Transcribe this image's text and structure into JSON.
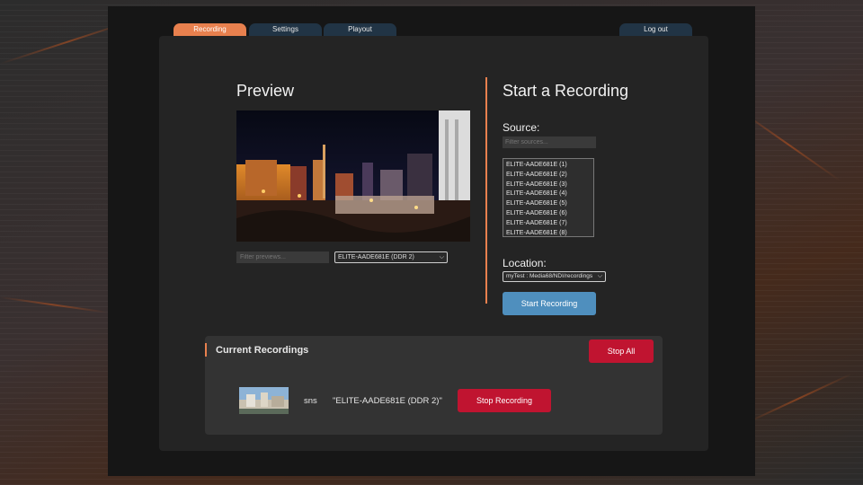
{
  "nav": {
    "tabs": [
      {
        "label": "Recording",
        "active": true
      },
      {
        "label": "Settings",
        "active": false
      },
      {
        "label": "Playout",
        "active": false
      }
    ],
    "logout_label": "Log out"
  },
  "preview": {
    "title": "Preview",
    "filter_placeholder": "Filter previews...",
    "selected_source": "ELITE-AADE681E (DDR 2)"
  },
  "start": {
    "title": "Start a Recording",
    "source_label": "Source:",
    "filter_placeholder": "Filter sources...",
    "sources": [
      "ELITE-AADE681E (1)",
      "ELITE-AADE681E (2)",
      "ELITE-AADE681E (3)",
      "ELITE-AADE681E (4)",
      "ELITE-AADE681E (5)",
      "ELITE-AADE681E (6)",
      "ELITE-AADE681E (7)",
      "ELITE-AADE681E (8)"
    ],
    "location_label": "Location:",
    "location_value": "myTest : Media68/NDI/recordings",
    "button_label": "Start Recording"
  },
  "current": {
    "title": "Current Recordings",
    "stop_all_label": "Stop All",
    "recordings": [
      {
        "name": "sns",
        "source": "\"ELITE-AADE681E (DDR 2)\"",
        "stop_label": "Stop Recording"
      }
    ]
  },
  "colors": {
    "accent": "#e8804e",
    "tab_bg": "#213445",
    "primary_button": "#4f8fbe",
    "danger_button": "#c01430"
  }
}
